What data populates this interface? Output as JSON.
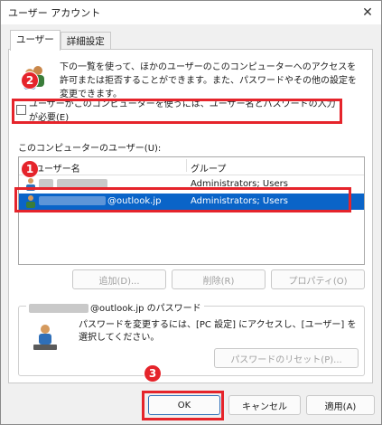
{
  "window": {
    "title": "ユーザー アカウント"
  },
  "tabs": [
    {
      "label": "ユーザー",
      "active": true
    },
    {
      "label": "詳細設定",
      "active": false
    }
  ],
  "intro_text": "下の一覧を使って、ほかのユーザーのこのコンピューターへのアクセスを許可または拒否することができます。また、パスワードやその他の設定を変更できます。",
  "require_login_checkbox": {
    "label": "ユーザーがこのコンピューターを使うには、ユーザー名とパスワードの入力が必要(E)",
    "checked": false
  },
  "users_section_label": "このコンピューターのユーザー(U):",
  "users_table": {
    "columns": [
      "ユーザー名",
      "グループ"
    ],
    "rows": [
      {
        "user": "",
        "group": "Administrators; Users",
        "selected": false
      },
      {
        "user": "@outlook.jp",
        "group": "Administrators; Users",
        "selected": true
      }
    ]
  },
  "buttons": {
    "add": "追加(D)...",
    "remove": "削除(R)",
    "properties": "プロパティ(O)",
    "reset_password": "パスワードのリセット(P)...",
    "ok": "OK",
    "cancel": "キャンセル",
    "apply": "適用(A)"
  },
  "password_group": {
    "title": "@outlook.jp のパスワード",
    "description": "パスワードを変更するには、[PC 設定] にアクセスし、[ユーザー] を選択してください。"
  },
  "annotations": [
    "2",
    "1",
    "3"
  ],
  "colors": {
    "highlight": "#e5242b",
    "selection": "#0a64c8"
  }
}
